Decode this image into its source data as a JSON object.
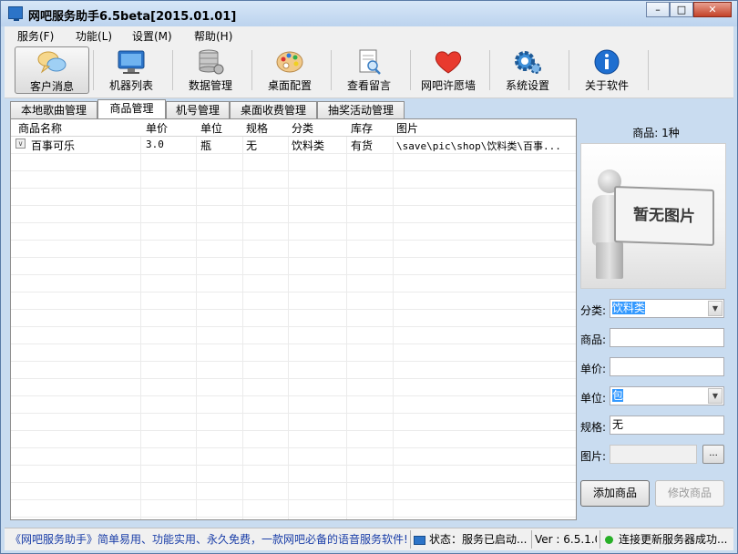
{
  "window": {
    "title": "网吧服务助手6.5beta[2015.01.01]"
  },
  "menu": [
    "服务(F)",
    "功能(L)",
    "设置(M)",
    "帮助(H)"
  ],
  "toolbar": [
    {
      "label": "客户消息",
      "icon": "chat-icon"
    },
    {
      "label": "机器列表",
      "icon": "monitor-icon"
    },
    {
      "label": "数据管理",
      "icon": "database-icon"
    },
    {
      "label": "桌面配置",
      "icon": "palette-icon"
    },
    {
      "label": "查看留言",
      "icon": "document-search-icon"
    },
    {
      "label": "网吧许愿墙",
      "icon": "heart-icon"
    },
    {
      "label": "系统设置",
      "icon": "gear-icon"
    },
    {
      "label": "关于软件",
      "icon": "info-icon"
    }
  ],
  "tabs": [
    "本地歌曲管理",
    "商品管理",
    "机号管理",
    "桌面收费管理",
    "抽奖活动管理"
  ],
  "active_tab": "商品管理",
  "table": {
    "columns": [
      "商品名称",
      "单价",
      "单位",
      "规格",
      "分类",
      "库存",
      "图片"
    ],
    "rows": [
      {
        "name": "百事可乐",
        "price": "3.0",
        "unit": "瓶",
        "spec": "无",
        "category": "饮料类",
        "stock": "有货",
        "image": "\\save\\pic\\shop\\饮料类\\百事..."
      }
    ]
  },
  "side": {
    "count": "商品: 1种",
    "placeholder_text": "暂无图片",
    "category_label": "分类:",
    "category_value": "饮料类",
    "product_label": "商品:",
    "product_value": "",
    "price_label": "单价:",
    "price_value": "",
    "unit_label": "单位:",
    "unit_value": "包",
    "spec_label": "规格:",
    "spec_value": "无",
    "image_label": "图片:",
    "image_value": "",
    "browse_label": "...",
    "add_button": "添加商品",
    "modify_button": "修改商品"
  },
  "status": {
    "slogan": "《网吧服务助手》简单易用、功能实用、永久免费，一款网吧必备的语音服务软件!",
    "state": "状态：服务已启动...",
    "version": "Ver : 6.5.1.0",
    "connection": "连接更新服务器成功..."
  }
}
